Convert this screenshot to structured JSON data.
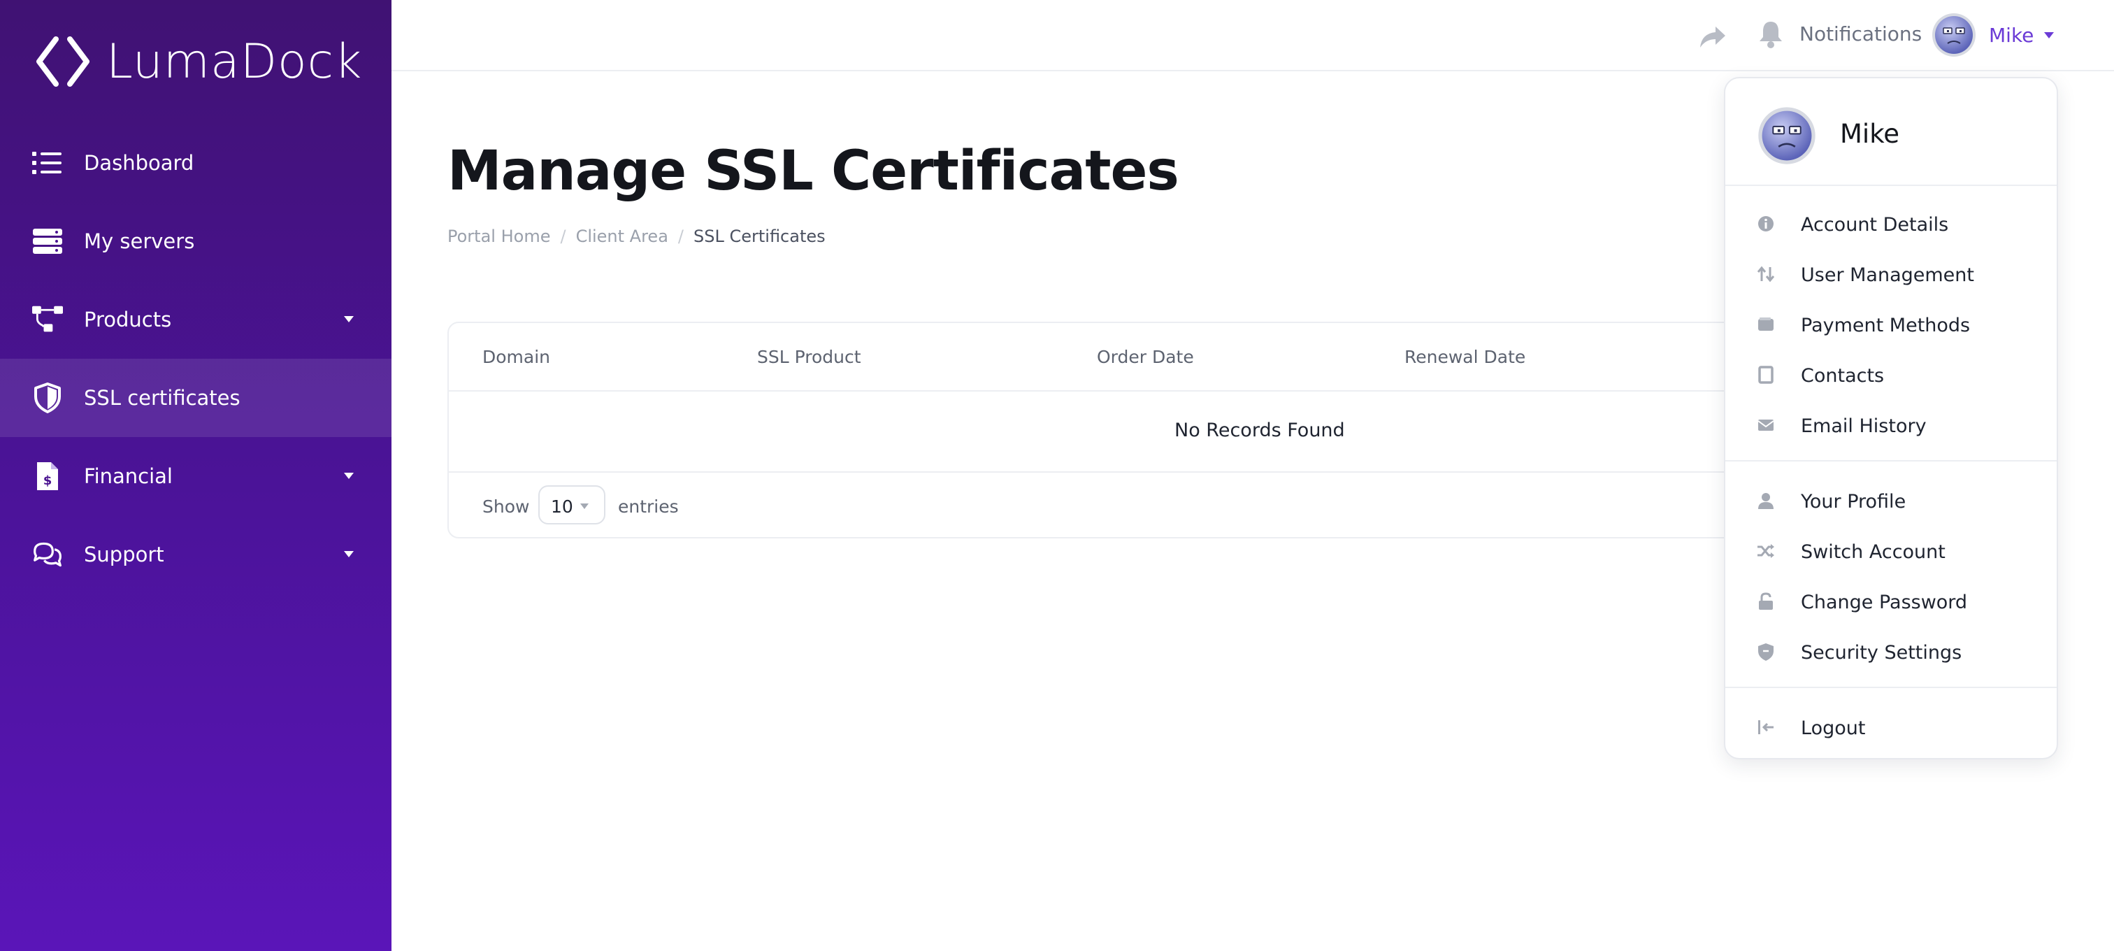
{
  "brand": {
    "name": "LumaDock"
  },
  "sidebar": {
    "items": [
      {
        "label": "Dashboard",
        "icon": "list-icon",
        "has_caret": false,
        "active": false
      },
      {
        "label": "My servers",
        "icon": "servers-icon",
        "has_caret": false,
        "active": false
      },
      {
        "label": "Products",
        "icon": "products-icon",
        "has_caret": true,
        "active": false
      },
      {
        "label": "SSL certificates",
        "icon": "shield-icon",
        "has_caret": false,
        "active": true
      },
      {
        "label": "Financial",
        "icon": "invoice-icon",
        "has_caret": true,
        "active": false
      },
      {
        "label": "Support",
        "icon": "chat-icon",
        "has_caret": true,
        "active": false
      }
    ]
  },
  "topbar": {
    "notifications_label": "Notifications",
    "user_name": "Mike"
  },
  "page": {
    "title": "Manage SSL Certificates",
    "breadcrumb": [
      "Portal Home",
      "Client Area",
      "SSL Certificates"
    ]
  },
  "table": {
    "columns": [
      "Domain",
      "SSL Product",
      "Order Date",
      "Renewal Date"
    ],
    "empty_message": "No Records Found",
    "show_label": "Show",
    "entries_value": "10",
    "entries_label": "entries"
  },
  "user_menu": {
    "name": "Mike",
    "account_items": [
      {
        "label": "Account Details",
        "icon": "info-icon"
      },
      {
        "label": "User Management",
        "icon": "sort-arrows-icon"
      },
      {
        "label": "Payment Methods",
        "icon": "wallet-icon"
      },
      {
        "label": "Contacts",
        "icon": "contact-card-icon"
      },
      {
        "label": "Email History",
        "icon": "envelope-icon"
      }
    ],
    "profile_items": [
      {
        "label": "Your Profile",
        "icon": "user-icon"
      },
      {
        "label": "Switch Account",
        "icon": "shuffle-icon"
      },
      {
        "label": "Change Password",
        "icon": "unlock-icon"
      },
      {
        "label": "Security Settings",
        "icon": "shield-small-icon"
      }
    ],
    "logout_label": "Logout"
  },
  "colors": {
    "sidebar_top": "#401273",
    "sidebar_bottom": "#5a15b8",
    "accent": "#6b3bd6",
    "muted_icon": "#a4a9b3"
  }
}
